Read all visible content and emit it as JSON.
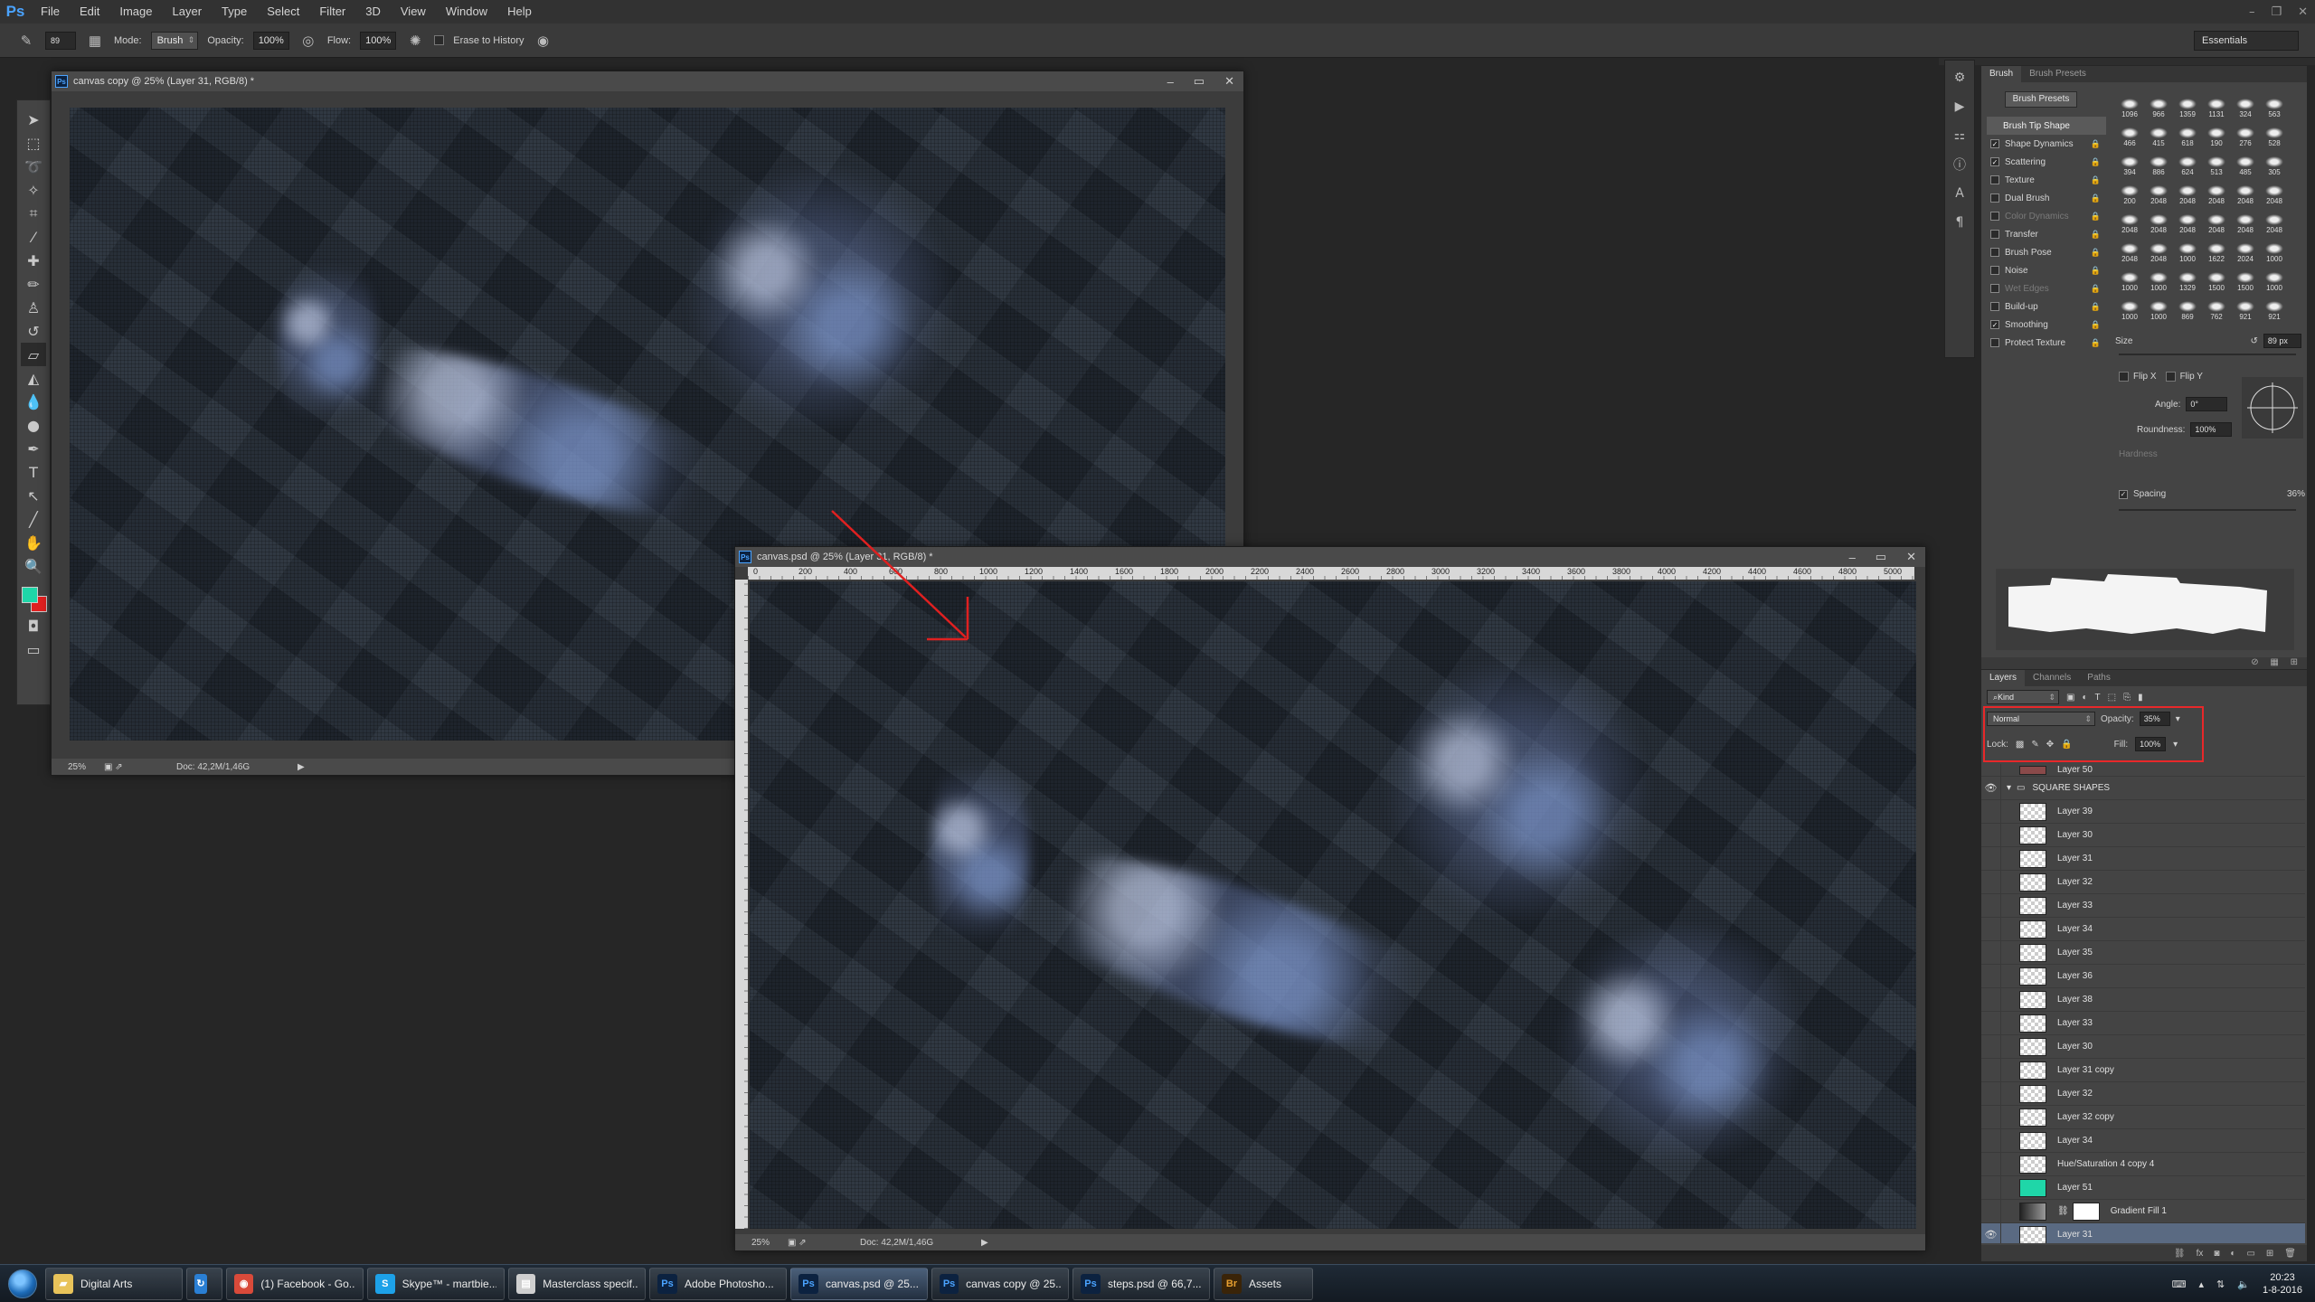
{
  "app": {
    "logo": "Ps"
  },
  "menubar": {
    "items": [
      "File",
      "Edit",
      "Image",
      "Layer",
      "Type",
      "Select",
      "Filter",
      "3D",
      "View",
      "Window",
      "Help"
    ]
  },
  "optionsbar": {
    "brush_size": "89",
    "mode_label": "Mode:",
    "mode_value": "Brush",
    "opacity_label": "Opacity:",
    "opacity_value": "100%",
    "flow_label": "Flow:",
    "flow_value": "100%",
    "erase_history_label": "Erase to History",
    "workspace": "Essentials"
  },
  "colors": {
    "foreground": "#1fd6a8",
    "background": "#e02020",
    "highlight": "#e8282a",
    "selected_layer": "#5a6a82"
  },
  "doc_back": {
    "title": "canvas copy @ 25% (Layer 31, RGB/8) *",
    "zoom": "25%",
    "doc_info": "Doc: 42,2M/1,46G"
  },
  "doc_front": {
    "title": "canvas.psd @ 25% (Layer 31, RGB/8) *",
    "zoom": "25%",
    "doc_info": "Doc: 42,2M/1,46G",
    "ruler_ticks": [
      "0",
      "200",
      "400",
      "600",
      "800",
      "1000",
      "1200",
      "1400",
      "1600",
      "1800",
      "2000",
      "2200",
      "2400",
      "2600",
      "2800",
      "3000",
      "3200",
      "3400",
      "3600",
      "3800",
      "4000",
      "4200",
      "4400",
      "4600",
      "4800",
      "5000"
    ]
  },
  "brush_panel": {
    "tabs": [
      "Brush",
      "Brush Presets"
    ],
    "presets_button": "Brush Presets",
    "options": [
      {
        "label": "Brush Tip Shape",
        "header": true
      },
      {
        "label": "Shape Dynamics",
        "checked": true
      },
      {
        "label": "Scattering",
        "checked": true
      },
      {
        "label": "Texture",
        "checked": false
      },
      {
        "label": "Dual Brush",
        "checked": false
      },
      {
        "label": "Color Dynamics",
        "checked": false,
        "dim": true
      },
      {
        "label": "Transfer",
        "checked": false
      },
      {
        "label": "Brush Pose",
        "checked": false
      },
      {
        "label": "Noise",
        "checked": false
      },
      {
        "label": "Wet Edges",
        "checked": false,
        "dim": true
      },
      {
        "label": "Build-up",
        "checked": false
      },
      {
        "label": "Smoothing",
        "checked": true
      },
      {
        "label": "Protect Texture",
        "checked": false
      }
    ],
    "tip_sizes": [
      "1096",
      "966",
      "1359",
      "1131",
      "324",
      "563",
      "466",
      "415",
      "618",
      "190",
      "276",
      "528",
      "394",
      "886",
      "624",
      "513",
      "485",
      "305",
      "200",
      "2048",
      "2048",
      "2048",
      "2048",
      "2048",
      "2048",
      "2048",
      "2048",
      "2048",
      "2048",
      "2048",
      "2048",
      "2048",
      "1000",
      "1622",
      "2024",
      "1000",
      "1000",
      "1000",
      "1329",
      "1500",
      "1500",
      "1000",
      "1000",
      "1000",
      "869",
      "762",
      "921",
      "921"
    ],
    "size_label": "Size",
    "size_value": "89 px",
    "flip_x": "Flip X",
    "flip_y": "Flip Y",
    "angle_label": "Angle:",
    "angle_value": "0°",
    "roundness_label": "Roundness:",
    "roundness_value": "100%",
    "hardness_label": "Hardness",
    "spacing_label": "Spacing",
    "spacing_value": "36%"
  },
  "layers_panel": {
    "tabs": [
      "Layers",
      "Channels",
      "Paths"
    ],
    "kind_label": "Kind",
    "blend_mode": "Normal",
    "opacity_label": "Opacity:",
    "opacity_value": "35%",
    "lock_label": "Lock:",
    "fill_label": "Fill:",
    "fill_value": "100%",
    "group_name": "SQUARE SHAPES",
    "top_layer": "Layer 50",
    "layers": [
      "Layer 39",
      "Layer 30",
      "Layer 31",
      "Layer 32",
      "Layer 33",
      "Layer 34",
      "Layer 35",
      "Layer 36",
      "Layer 38",
      "Layer 33",
      "Layer 30",
      "Layer 31 copy",
      "Layer 32",
      "Layer 32 copy",
      "Layer 34",
      "Hue/Saturation 4 copy 4"
    ],
    "bottom_layers": [
      "Layer 51",
      "Gradient Fill 1",
      "Layer 31"
    ]
  },
  "taskbar": {
    "tasks": [
      {
        "label": "Digital Arts",
        "icon": "folder-icon",
        "color": "#e8c35a"
      },
      {
        "label": "",
        "icon": "refresh-icon",
        "color": "#2a7fd4"
      },
      {
        "label": "(1) Facebook - Go...",
        "icon": "chrome-icon",
        "color": "#d94a3a"
      },
      {
        "label": "Skype™ - martbie...",
        "icon": "skype-icon",
        "color": "#1da1e8"
      },
      {
        "label": "Masterclass specif...",
        "icon": "document-icon",
        "color": "#cfcfcf"
      },
      {
        "label": "Adobe Photosho...",
        "icon": "photoshop-icon",
        "color": "#0c2240"
      },
      {
        "label": "canvas.psd @ 25...",
        "icon": "photoshop-icon",
        "color": "#0c2240"
      },
      {
        "label": "canvas copy @ 25...",
        "icon": "photoshop-icon",
        "color": "#0c2240"
      },
      {
        "label": "steps.psd @ 66,7...",
        "icon": "photoshop-icon",
        "color": "#0c2240"
      },
      {
        "label": "Assets",
        "icon": "bridge-icon",
        "color": "#3a2408"
      }
    ],
    "time": "20:23",
    "date": "1-8-2016"
  }
}
